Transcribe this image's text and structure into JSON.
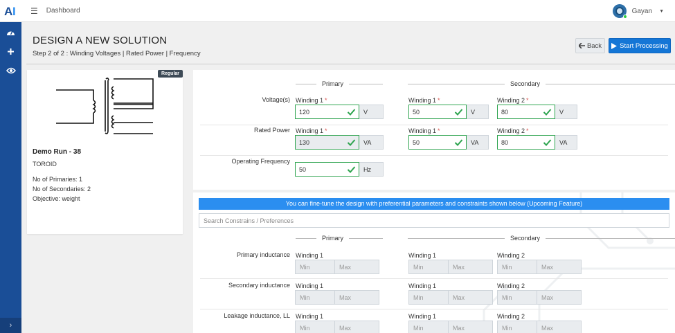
{
  "app": {
    "logo_text": "AI",
    "breadcrumb": "Dashboard",
    "user_name": "Gayan"
  },
  "colors": {
    "sidebar": "#1a4e97",
    "primary_button": "#1476d6",
    "info_bar": "#2b8ef0",
    "valid_border": "#2ea44f"
  },
  "sidebar": {
    "items": [
      {
        "icon": "speedometer-icon"
      },
      {
        "icon": "plus-icon"
      },
      {
        "icon": "eye-icon"
      }
    ],
    "toggle": "›"
  },
  "header": {
    "title": "DESIGN A NEW SOLUTION",
    "subtitle": "Step 2 of 2 : Winding Voltages | Rated Power | Frequency",
    "back_label": "Back",
    "start_label": "Start Processing"
  },
  "card": {
    "badge": "Regular",
    "name": "Demo Run - 38",
    "type": "TOROID",
    "primaries": "No of Primaries: 1",
    "secondaries": "No of Secondaries: 2",
    "objective": "Objective: weight"
  },
  "form": {
    "primary_heading": "Primary",
    "secondary_heading": "Secondary",
    "voltage": {
      "label": "Voltage(s)",
      "p1": {
        "label": "Winding 1",
        "value": "120",
        "unit": "V"
      },
      "s1": {
        "label": "Winding 1",
        "value": "50",
        "unit": "V"
      },
      "s2": {
        "label": "Winding 2",
        "value": "80",
        "unit": "V"
      }
    },
    "power": {
      "label": "Rated Power",
      "p1": {
        "label": "Winding 1",
        "value": "130",
        "unit": "VA"
      },
      "s1": {
        "label": "Winding 1",
        "value": "50",
        "unit": "VA"
      },
      "s2": {
        "label": "Winding 2",
        "value": "80",
        "unit": "VA"
      }
    },
    "frequency": {
      "label": "Operating Frequency",
      "value": "50",
      "unit": "Hz"
    },
    "required_mark": "*"
  },
  "constraints": {
    "info": "You can fine-tune the design with preferential parameters and constraints shown below (Upcoming Feature)",
    "search_placeholder": "Search Constrains / Preferences",
    "primary_heading": "Primary",
    "secondary_heading": "Secondary",
    "min_placeholder": "Min",
    "max_placeholder": "Max",
    "rows": [
      {
        "label": "Primary inductance",
        "p1": "Winding 1",
        "s1": "Winding 1",
        "s2": "Winding 2"
      },
      {
        "label": "Secondary inductance",
        "p1": "Winding 1",
        "s1": "Winding 1",
        "s2": "Winding 2"
      },
      {
        "label": "Leakage inductance, LL",
        "p1": "Winding 1",
        "s1": "Winding 1",
        "s2": "Winding 2"
      }
    ]
  }
}
